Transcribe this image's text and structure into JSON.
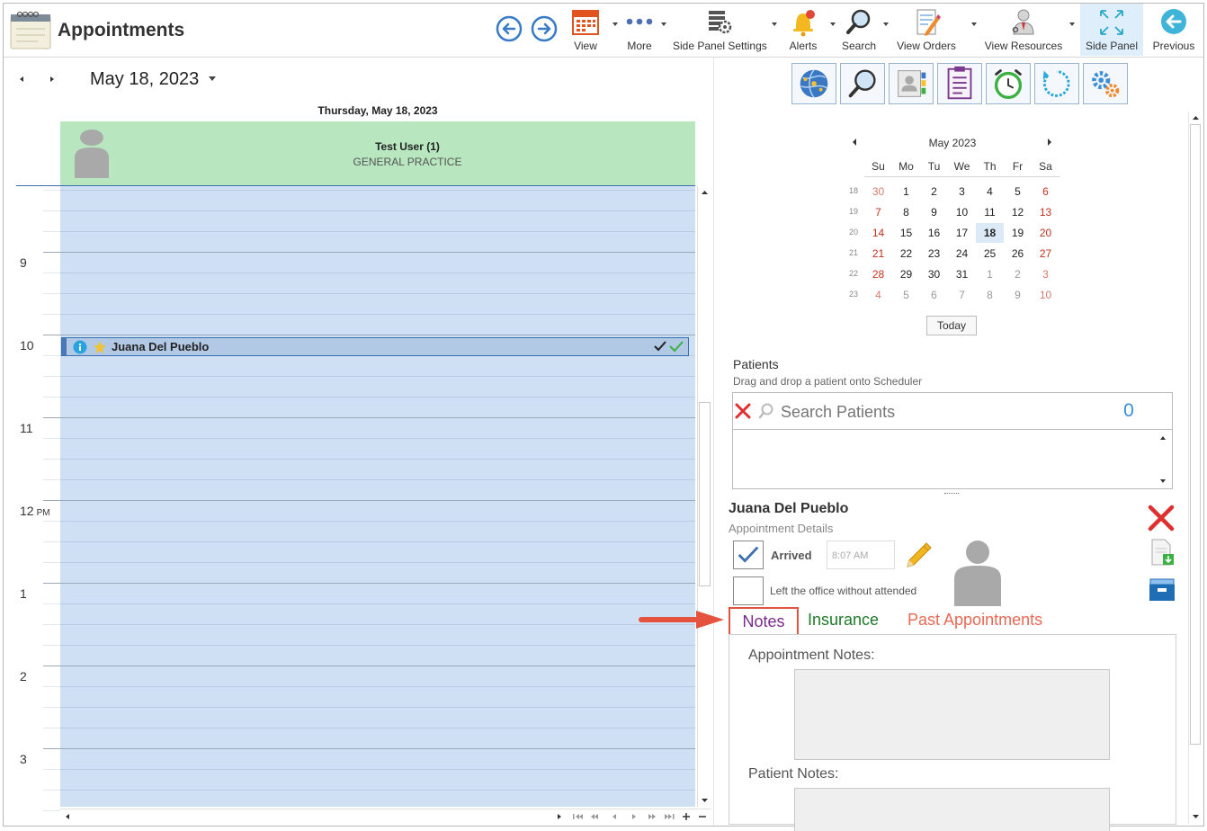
{
  "app": {
    "title": "Appointments"
  },
  "toolbar": {
    "buttons": [
      {
        "label": "View",
        "icon": "calendar-icon"
      },
      {
        "label": "More",
        "icon": "more-dots-icon"
      },
      {
        "label": "Side Panel Settings",
        "icon": "grid-settings-icon"
      },
      {
        "label": "Alerts",
        "icon": "bell-icon"
      },
      {
        "label": "Search",
        "icon": "search-icon"
      },
      {
        "label": "View Orders",
        "icon": "orders-icon"
      },
      {
        "label": "View Resources",
        "icon": "resources-icon"
      },
      {
        "label": "Side Panel",
        "icon": "expand-icon"
      },
      {
        "label": "Previous",
        "icon": "back-circle-icon"
      }
    ]
  },
  "scheduler": {
    "current_date": "May 18, 2023",
    "day_header": "Thursday, May 18, 2023",
    "resource": {
      "name": "Test User (1)",
      "department": "GENERAL PRACTICE"
    },
    "time_labels": [
      {
        "hour": "9",
        "ampm": ""
      },
      {
        "hour": "10",
        "ampm": ""
      },
      {
        "hour": "11",
        "ampm": ""
      },
      {
        "hour": "12",
        "ampm": "PM"
      },
      {
        "hour": "1",
        "ampm": ""
      },
      {
        "hour": "2",
        "ampm": ""
      },
      {
        "hour": "3",
        "ampm": ""
      }
    ],
    "appointment": {
      "patient": "Juana Del Pueblo"
    }
  },
  "mini_calendar": {
    "month": "May 2023",
    "weekdays": [
      "Su",
      "Mo",
      "Tu",
      "We",
      "Th",
      "Fr",
      "Sa"
    ],
    "weeks": [
      {
        "num": "18",
        "days": [
          "30",
          "1",
          "2",
          "3",
          "4",
          "5",
          "6"
        ]
      },
      {
        "num": "19",
        "days": [
          "7",
          "8",
          "9",
          "10",
          "11",
          "12",
          "13"
        ]
      },
      {
        "num": "20",
        "days": [
          "14",
          "15",
          "16",
          "17",
          "18",
          "19",
          "20"
        ]
      },
      {
        "num": "21",
        "days": [
          "21",
          "22",
          "23",
          "24",
          "25",
          "26",
          "27"
        ]
      },
      {
        "num": "22",
        "days": [
          "28",
          "29",
          "30",
          "31",
          "1",
          "2",
          "3"
        ]
      },
      {
        "num": "23",
        "days": [
          "4",
          "5",
          "6",
          "7",
          "8",
          "9",
          "10"
        ]
      }
    ],
    "selected_day": "18",
    "today_label": "Today"
  },
  "patients": {
    "title": "Patients",
    "hint": "Drag and drop a patient onto Scheduler",
    "search_placeholder": "Search Patients",
    "count": "0"
  },
  "details": {
    "name": "Juana Del Pueblo",
    "subtitle": "Appointment Details",
    "arrived_label": "Arrived",
    "arrived_time": "8:07 AM",
    "left_label": "Left the office without attended",
    "tabs": {
      "notes": "Notes",
      "insurance": "Insurance",
      "past": "Past Appointments"
    },
    "appointment_notes_label": "Appointment Notes:",
    "patient_notes_label": "Patient Notes:"
  },
  "colors": {
    "resource_header": "#b8e6bf",
    "grid_bg": "#cfe0f4",
    "appointment": "#b2c9e6",
    "callout": "#e5533f",
    "link_blue": "#3b8fd9"
  }
}
